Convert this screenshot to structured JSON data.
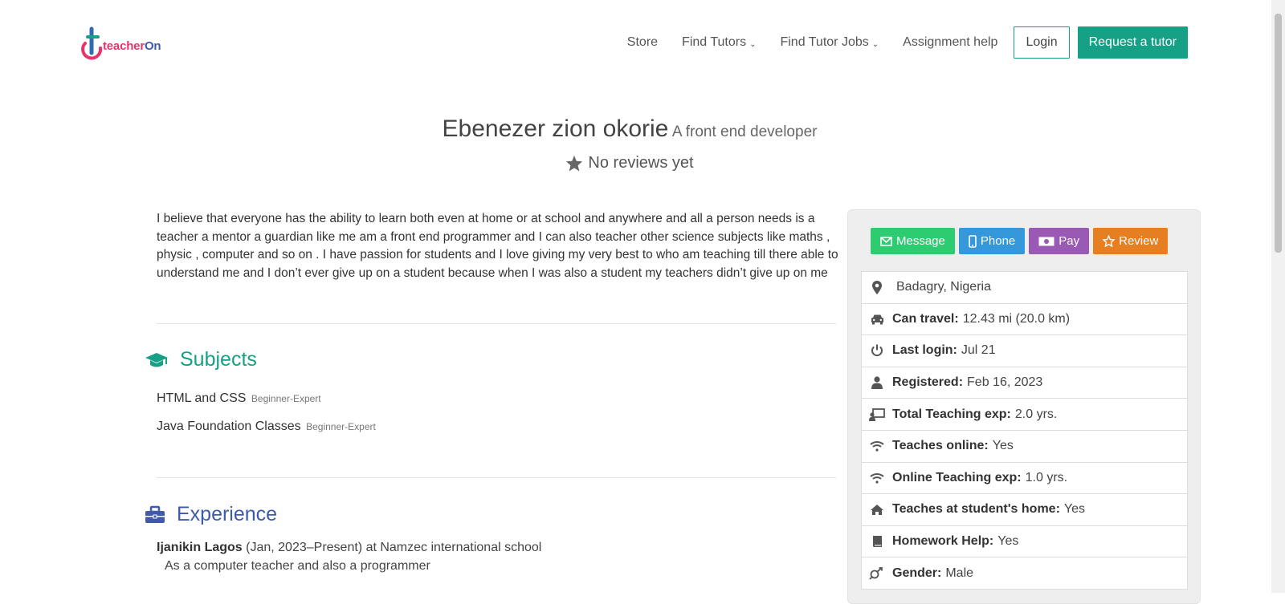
{
  "header": {
    "logo_text_1": "teacher",
    "logo_text_2": "On",
    "nav": [
      {
        "label": "Store",
        "has_caret": false
      },
      {
        "label": "Find Tutors",
        "has_caret": true
      },
      {
        "label": "Find Tutor Jobs",
        "has_caret": true
      },
      {
        "label": "Assignment help",
        "has_caret": false
      }
    ],
    "caret": "⌄",
    "login_label": "Login",
    "request_label": "Request a tutor"
  },
  "profile": {
    "name": "Ebenezer zion okorie",
    "headline": "A front end developer",
    "reviews": "No reviews yet",
    "bio": "I believe that everyone has the ability to learn both even at home or at school and anywhere and all a person needs is a teacher a mentor a guardian like me am a front end programmer and I can also teacher other science subjects like maths , physic , computer and so on . I have passion for students and I love giving my very best to who am teaching till there able to understand me and I don’t ever give up on a student because when I was also a student my teachers didn’t give up on me"
  },
  "subjects": {
    "heading": "Subjects",
    "items": [
      {
        "name": "HTML and CSS",
        "level": "Beginner-Expert"
      },
      {
        "name": "Java Foundation Classes",
        "level": "Beginner-Expert"
      }
    ]
  },
  "experience": {
    "heading": "Experience",
    "company": "Ijanikin Lagos",
    "period": "(Jan, 2023–Present) at Namzec international school",
    "description": "As a computer teacher and also a programmer"
  },
  "sidebar": {
    "buttons": {
      "message": "Message",
      "phone": "Phone",
      "pay": "Pay",
      "review": "Review"
    },
    "info": [
      {
        "icon": "map-marker-icon",
        "label": "",
        "value": "Badagry, Nigeria"
      },
      {
        "icon": "car-icon",
        "label": "Can travel:",
        "value": "12.43 mi (20.0 km)"
      },
      {
        "icon": "power-icon",
        "label": "Last login:",
        "value": "Jul 21"
      },
      {
        "icon": "user-icon",
        "label": "Registered:",
        "value": "Feb 16, 2023"
      },
      {
        "icon": "teacher-board-icon",
        "label": "Total Teaching exp:",
        "value": "2.0 yrs."
      },
      {
        "icon": "wifi-icon",
        "label": "Teaches online:",
        "value": "Yes"
      },
      {
        "icon": "wifi-icon",
        "label": "Online Teaching exp:",
        "value": "1.0 yrs."
      },
      {
        "icon": "home-icon",
        "label": "Teaches at student's home:",
        "value": "Yes"
      },
      {
        "icon": "book-icon",
        "label": "Homework Help:",
        "value": "Yes"
      },
      {
        "icon": "gender-icon",
        "label": "Gender:",
        "value": "Male"
      }
    ]
  },
  "colors": {
    "brand_green": "#16a085",
    "brand_blue": "#3f5aa8",
    "brand_pink": "#e8336b",
    "message": "#2ecc71",
    "phone": "#3498db",
    "pay": "#9b59b6",
    "review": "#e67e22"
  }
}
